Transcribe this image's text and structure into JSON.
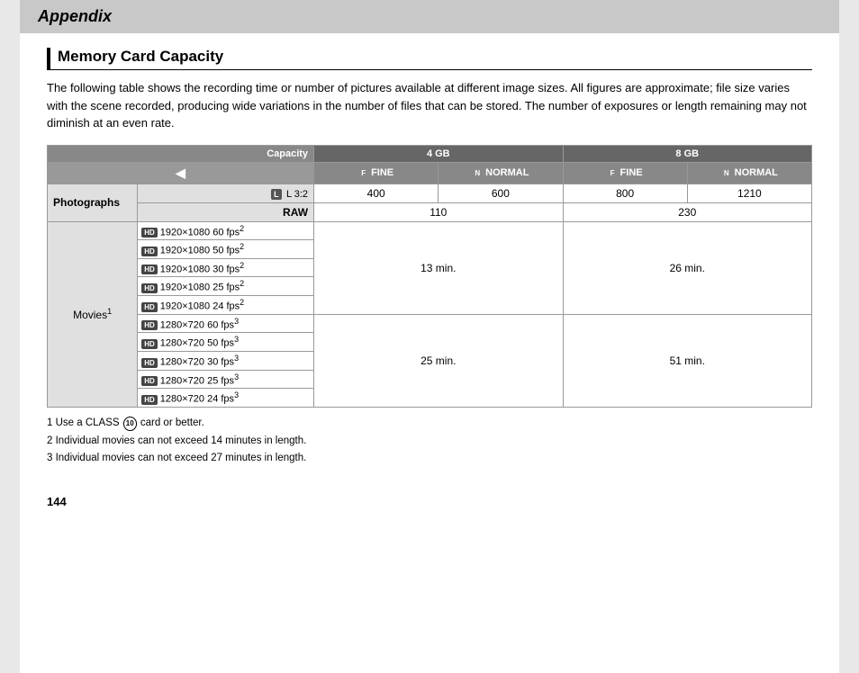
{
  "header": {
    "title": "Appendix"
  },
  "section": {
    "title": "Memory Card Capacity",
    "intro": "The following table shows the recording time or number of pictures available at different image sizes. All figures are approximate; file size varies with the scene recorded, producing wide variations in the number of files that can be stored.  The number of exposures or length remaining may not diminish at an even rate."
  },
  "table": {
    "capacity_label": "Capacity",
    "col_4gb": "4 GB",
    "col_8gb": "8 GB",
    "fine_label": "FINE",
    "normal_label": "NORMAL",
    "fine_label2": "FINE",
    "normal_label2": "NORMAL",
    "rows": {
      "photographs_label": "Photographs",
      "photo_mode": "L 3:2",
      "photo_raw": "RAW",
      "photo_32_4gb_fine": "400",
      "photo_32_4gb_normal": "600",
      "photo_32_8gb_fine": "800",
      "photo_32_8gb_normal": "1210",
      "photo_raw_4gb": "110",
      "photo_raw_8gb": "230",
      "movies_label": "Movies",
      "movies_sup": "1",
      "movies_1080_time_4gb": "13 min.",
      "movies_1080_time_8gb": "26 min.",
      "movies_720_time_4gb": "25 min.",
      "movies_720_time_8gb": "51 min.",
      "res_1080_60": "1920×1080 60 fps",
      "res_1080_60_sup": "2",
      "res_1080_50": "1920×1080 50 fps",
      "res_1080_50_sup": "2",
      "res_1080_30": "1920×1080 30 fps",
      "res_1080_30_sup": "2",
      "res_1080_25": "1920×1080 25 fps",
      "res_1080_25_sup": "2",
      "res_1080_24": "1920×1080 24 fps",
      "res_1080_24_sup": "2",
      "res_720_60": "1280×720 60 fps",
      "res_720_60_sup": "3",
      "res_720_50": "1280×720 50 fps",
      "res_720_50_sup": "3",
      "res_720_30": "1280×720 30 fps",
      "res_720_30_sup": "3",
      "res_720_25": "1280×720 25 fps",
      "res_720_25_sup": "3",
      "res_720_24": "1280×720 24 fps",
      "res_720_24_sup": "3"
    }
  },
  "footnotes": {
    "fn1": "1 Use a CLASS",
    "fn1_class": "10",
    "fn1_end": "card or better.",
    "fn2": "2 Individual movies can not exceed 14 minutes in length.",
    "fn3": "3 Individual movies can not exceed 27 minutes in length."
  },
  "page_number": "144"
}
